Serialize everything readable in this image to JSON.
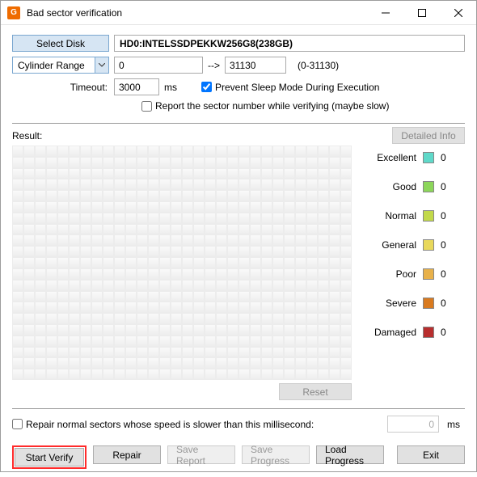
{
  "window": {
    "title": "Bad sector verification",
    "icon_glyph": "G"
  },
  "topbar": {
    "select_disk_btn": "Select Disk",
    "disk_name": "HD0:INTELSSDPEKKW256G8(238GB)"
  },
  "range": {
    "mode_label": "Cylinder Range",
    "from": "0",
    "arrow": "-->",
    "to": "31130",
    "hint": "(0-31130)"
  },
  "timeout": {
    "label": "Timeout:",
    "value": "3000",
    "unit": "ms"
  },
  "options": {
    "prevent_sleep": {
      "label": "Prevent Sleep Mode During Execution",
      "checked": true
    },
    "report_sector": {
      "label": "Report the sector number while verifying (maybe slow)",
      "checked": false
    }
  },
  "result": {
    "label": "Result:",
    "detailed_btn": "Detailed Info",
    "reset_btn": "Reset"
  },
  "legend": {
    "items": [
      {
        "label": "Excellent",
        "color": "#5fd9c9",
        "count": "0"
      },
      {
        "label": "Good",
        "color": "#8cd65a",
        "count": "0"
      },
      {
        "label": "Normal",
        "color": "#c2d94a",
        "count": "0"
      },
      {
        "label": "General",
        "color": "#e8d85b",
        "count": "0"
      },
      {
        "label": "Poor",
        "color": "#e8b14a",
        "count": "0"
      },
      {
        "label": "Severe",
        "color": "#d97a1f",
        "count": "0"
      },
      {
        "label": "Damaged",
        "color": "#b82e2e",
        "count": "0"
      }
    ]
  },
  "repair_option": {
    "label": "Repair normal sectors whose speed is slower than this millisecond:",
    "value": "0",
    "unit": "ms",
    "checked": false
  },
  "buttons": {
    "start": "Start Verify",
    "repair": "Repair",
    "save_report": "Save Report",
    "save_progress": "Save Progress",
    "load_progress": "Load Progress",
    "exit": "Exit"
  }
}
